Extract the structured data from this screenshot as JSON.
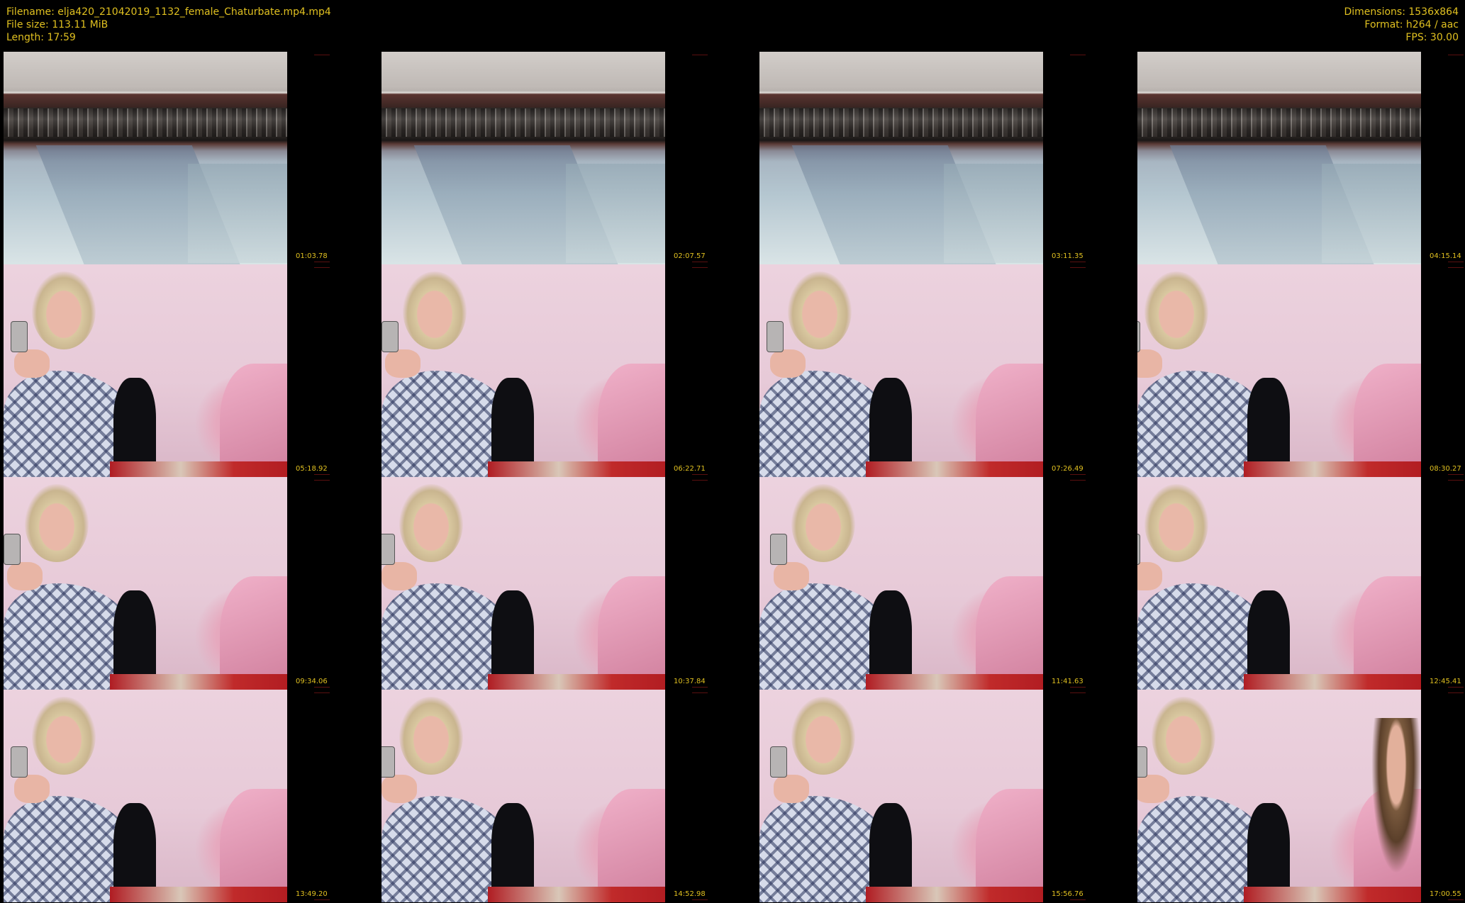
{
  "header": {
    "filename_line": "Filename: elja420_21042019_1132_female_Chaturbate.mp4.mp4",
    "filesize_line": "File size: 113.11 MiB",
    "length_line": "Length: 17:59",
    "dimensions_line": "Dimensions: 1536x864",
    "format_line": "Format: h264 / aac",
    "fps_line": "FPS: 30.00"
  },
  "colors": {
    "background": "#000000",
    "text": "#e0c020"
  },
  "thumbnails": [
    {
      "timestamp": "01:03.78",
      "scene": "screen"
    },
    {
      "timestamp": "02:07.57",
      "scene": "screen"
    },
    {
      "timestamp": "03:11.35",
      "scene": "screen"
    },
    {
      "timestamp": "04:15.14",
      "scene": "screen"
    },
    {
      "timestamp": "05:18.92",
      "scene": "room"
    },
    {
      "timestamp": "06:22.71",
      "scene": "room"
    },
    {
      "timestamp": "07:26.49",
      "scene": "room"
    },
    {
      "timestamp": "08:30.27",
      "scene": "room"
    },
    {
      "timestamp": "09:34.06",
      "scene": "room"
    },
    {
      "timestamp": "10:37.84",
      "scene": "room"
    },
    {
      "timestamp": "11:41.63",
      "scene": "room"
    },
    {
      "timestamp": "12:45.41",
      "scene": "room"
    },
    {
      "timestamp": "13:49.20",
      "scene": "room"
    },
    {
      "timestamp": "14:52.98",
      "scene": "room"
    },
    {
      "timestamp": "15:56.76",
      "scene": "room"
    },
    {
      "timestamp": "17:00.55",
      "scene": "room-guest"
    }
  ]
}
